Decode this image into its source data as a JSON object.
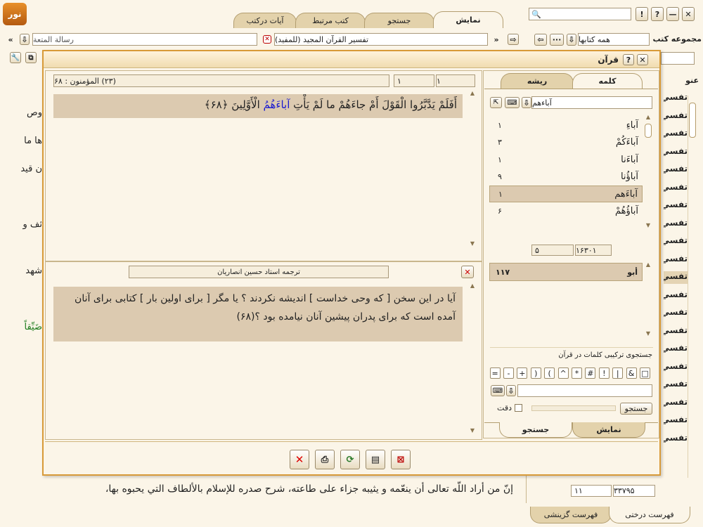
{
  "app": {
    "logo_text": "نور",
    "search_value": ""
  },
  "top_tabs": [
    "نمایش",
    "جستجو",
    "کتب مرتبط",
    "آيات درکتب"
  ],
  "window_controls": {
    "help": "?",
    "info": "!",
    "minimize": "—",
    "close": "✕"
  },
  "toolbar": {
    "book_group_label": "مجموعه کتب",
    "book_group_value": "همه کتابها",
    "book_title": "تفسير القرآن المجيد (للمفيد)",
    "book_left": "رسالة المتعة",
    "sidebar_header_partial": "عنو"
  },
  "background_lines": [
    "وص",
    "ها ما",
    "ن قيد",
    "ثف و",
    "شهد",
    "ضَيِّقاً"
  ],
  "background_bottom_text": "إنّ من أراد اللّه تعالى أن ينعّمه و يثيبه جزاء على طاعته، شرح صدره للإسلام بالألطاف التي يحبوه بها،",
  "sidebar_items": [
    "تفسي",
    "تفسي",
    "تفسي",
    "تفسي",
    "تفسي",
    "تفسي",
    "تفسي",
    "تفسي",
    "تفسي",
    "تفسي",
    "تفسي",
    "تفسي",
    "تفسي",
    "تفسي",
    "تفسي",
    "تفسي",
    "تفسي",
    "تفسي",
    "تفسي",
    "تفسي"
  ],
  "bottom_counts": {
    "total": "۳۳۷۹۵",
    "current": "۱۱"
  },
  "bottom_tabs": [
    "فهرست درختی",
    "فهرست گزینشی"
  ],
  "dialog": {
    "title": "قرآن",
    "left_tabs": [
      "کلمه",
      "ریشه"
    ],
    "search_value": "آباءهم",
    "words": [
      {
        "word": "آباءِ",
        "count": "۱"
      },
      {
        "word": "آباءَكُمْ",
        "count": "۳"
      },
      {
        "word": "آباءَنا",
        "count": "۱"
      },
      {
        "word": "آباؤُنا",
        "count": "۹"
      },
      {
        "word": "آباءَهم",
        "count": "۱"
      },
      {
        "word": "آباؤُهُمْ",
        "count": "۶"
      }
    ],
    "word_counter": {
      "total": "۱۶۳۰۱",
      "current": "۵"
    },
    "roots": [
      {
        "root": "أبو",
        "count": "۱۱۷"
      }
    ],
    "combo_title": "جستجوی ترکیبی کلمات در قرآن",
    "ops": [
      "□",
      "&",
      "|",
      "!",
      "#",
      "*",
      "^",
      "(",
      ")",
      "+",
      "-",
      "="
    ],
    "combo_search_label": "جستجو",
    "precision_label": "دقت",
    "bottom_tabs": [
      "نمایش",
      "جستجو"
    ],
    "verse_header": {
      "page": "۱",
      "of": "۱",
      "sura": "(۲۳) المؤمنون : ۶۸"
    },
    "verse_before": "أَفَلَمْ يَدَّبَّرُوا الْقَوْلَ أَمْ جاءَهُمْ ما لَمْ يَأْتِ",
    "verse_highlight": "آباءَهُمُ",
    "verse_after": "الْأَوَّلِينَ ﴿۶۸﴾",
    "translator": "ترجمه استاد حسين انصاريان",
    "translation": "آيا در اين سخن [ كه وحى خداست ] انديشه نكردند ؟ يا مگر [ براى اولين بار ] كتابى براى آنان آمده است كه براى پدران پيشين آنان نيامده بود ؟(۶۸)",
    "actions": [
      "close",
      "print",
      "export",
      "copy",
      "save"
    ]
  }
}
